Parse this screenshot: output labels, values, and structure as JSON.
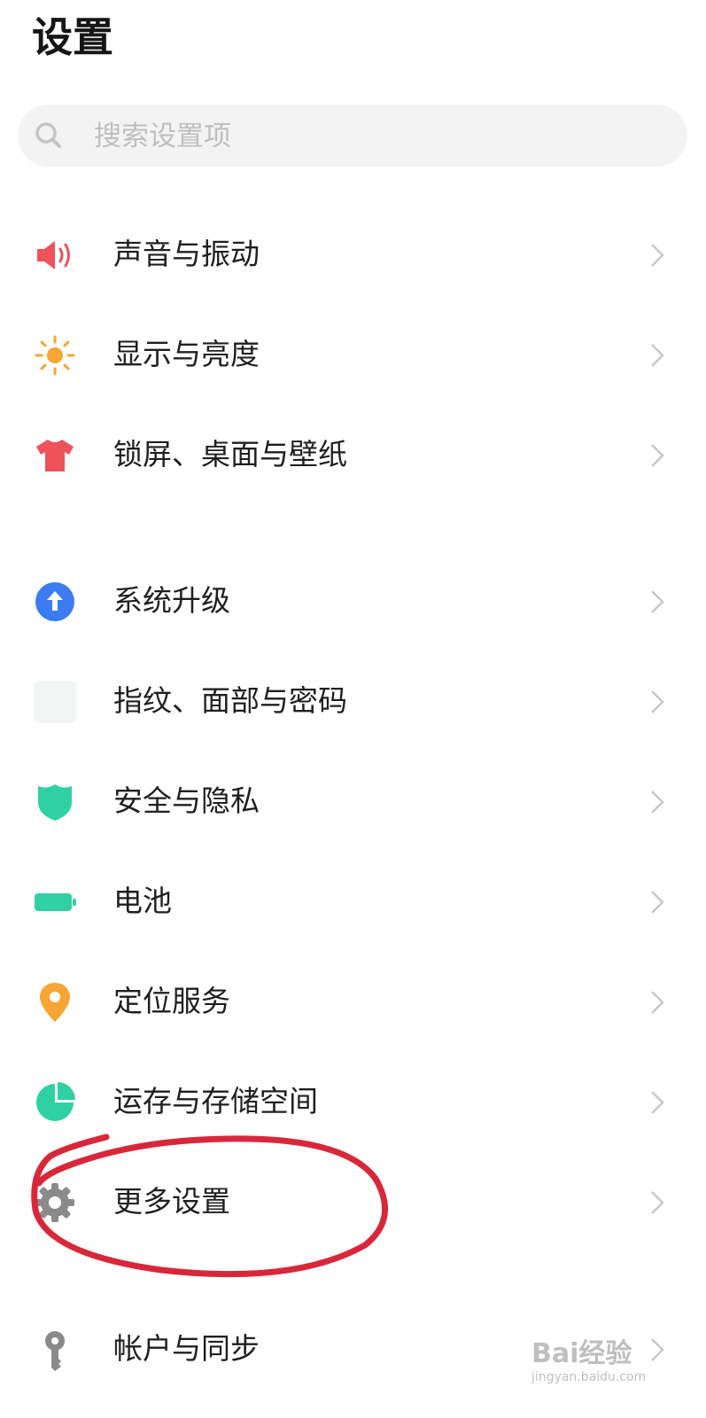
{
  "header": {
    "title": "设置"
  },
  "search": {
    "placeholder": "搜索设置项"
  },
  "items": [
    {
      "label": "声音与振动",
      "icon": "speaker-icon",
      "color": "#f0525b"
    },
    {
      "label": "显示与亮度",
      "icon": "sun-icon",
      "color": "#f7a534"
    },
    {
      "label": "锁屏、桌面与壁纸",
      "icon": "tshirt-icon",
      "color": "#f0525b"
    },
    {
      "label": "系统升级",
      "icon": "upgrade-arrow-icon",
      "color": "#3d7cf0"
    },
    {
      "label": "指纹、面部与密码",
      "icon": "fingerprint-icon",
      "color": "#f2f6f4"
    },
    {
      "label": "安全与隐私",
      "icon": "shield-icon",
      "color": "#2fd1a4"
    },
    {
      "label": "电池",
      "icon": "battery-icon",
      "color": "#2fd1a4"
    },
    {
      "label": "定位服务",
      "icon": "location-pin-icon",
      "color": "#f7a534"
    },
    {
      "label": "运存与存储空间",
      "icon": "pie-chart-icon",
      "color": "#2fd1a4"
    },
    {
      "label": "更多设置",
      "icon": "gear-icon",
      "color": "#8a8a8a"
    },
    {
      "label": "帐户与同步",
      "icon": "key-icon",
      "color": "#8a8a8a"
    }
  ],
  "watermark": {
    "brand": "Bai经验",
    "url": "jingyan.baidu.com"
  },
  "annotation_color": "#d9273a"
}
